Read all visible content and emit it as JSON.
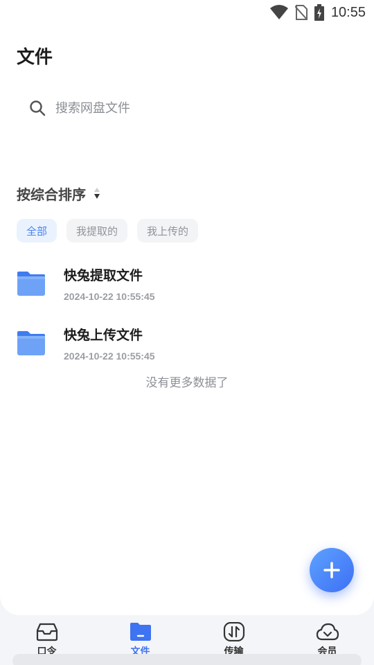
{
  "status_bar": {
    "time": "10:55",
    "icons": [
      "wifi-icon",
      "no-sim-icon",
      "battery-charging-icon"
    ]
  },
  "header": {
    "title": "文件"
  },
  "search": {
    "placeholder": "搜索网盘文件",
    "icon": "search-icon"
  },
  "sort": {
    "label": "按综合排序",
    "icon": "sort-caret-icon"
  },
  "filters": [
    {
      "label": "全部",
      "active": true
    },
    {
      "label": "我提取的",
      "active": false
    },
    {
      "label": "我上传的",
      "active": false
    }
  ],
  "files": [
    {
      "name": "快兔提取文件",
      "date": "2024-10-22 10:55:45",
      "icon": "folder-icon"
    },
    {
      "name": "快兔上传文件",
      "date": "2024-10-22 10:55:45",
      "icon": "folder-icon"
    }
  ],
  "empty_hint": "没有更多数据了",
  "fab": {
    "icon": "plus-icon"
  },
  "tabs": [
    {
      "label": "口令",
      "icon": "inbox-icon",
      "active": false
    },
    {
      "label": "文件",
      "icon": "folder-icon",
      "active": true
    },
    {
      "label": "传输",
      "icon": "transfer-icon",
      "active": false
    },
    {
      "label": "会员",
      "icon": "cloud-icon",
      "active": false
    }
  ],
  "colors": {
    "accent": "#3e73f2",
    "chip_active_bg": "#eaf2fe",
    "folder": "#5d95f5"
  }
}
